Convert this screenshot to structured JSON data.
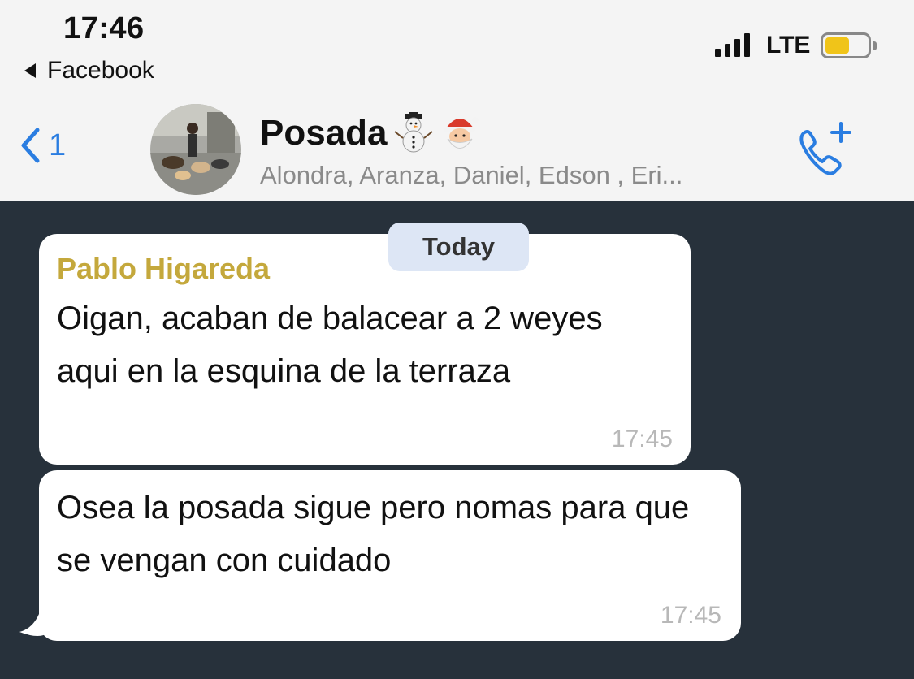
{
  "status_bar": {
    "time": "17:46",
    "back_app": "Facebook",
    "network": "LTE",
    "battery_level": 0.58
  },
  "header": {
    "back_count": "1",
    "group_name": "Posada",
    "group_emojis": [
      "snowman-icon",
      "santa-icon"
    ],
    "members": "Alondra, Aranza, Daniel, Edson , Eri..."
  },
  "chat": {
    "date_label": "Today",
    "messages": [
      {
        "sender": "Pablo Higareda",
        "text": "Oigan, acaban de balacear a 2 weyes aqui en la esquina de la terraza",
        "time": "17:45"
      },
      {
        "text": "Osea la posada sigue pero nomas para que se vengan con cuidado",
        "time": "17:45"
      }
    ]
  },
  "colors": {
    "accent": "#2a7de1",
    "chat_background": "#27313b",
    "sender_name": "#c4a83c",
    "date_pill": "#dde6f5",
    "battery": "#f0c419"
  }
}
